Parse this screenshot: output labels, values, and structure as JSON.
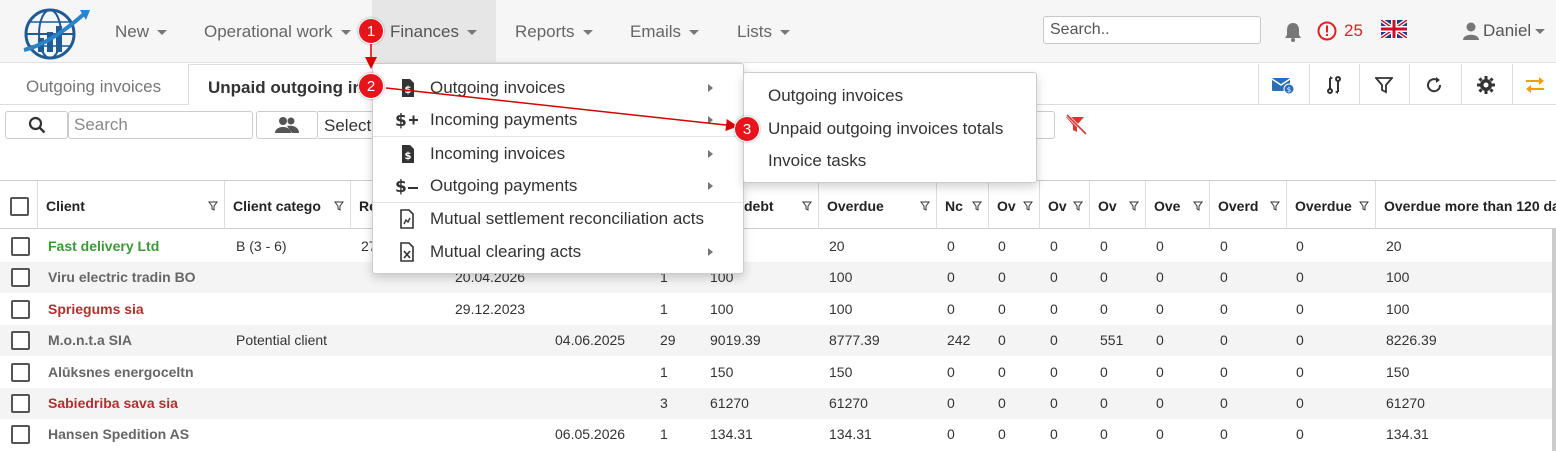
{
  "navbar": {
    "items": [
      {
        "label": "New"
      },
      {
        "label": "Operational work"
      },
      {
        "label": "Finances"
      },
      {
        "label": "Reports"
      },
      {
        "label": "Emails"
      },
      {
        "label": "Lists"
      }
    ],
    "search_placeholder": "Search..",
    "alert_count": "25",
    "user_name": "Daniel"
  },
  "tabs": [
    {
      "label": "Outgoing invoices"
    },
    {
      "label": "Unpaid outgoing invo"
    }
  ],
  "filter": {
    "search_placeholder": "Search",
    "select_text": "Select"
  },
  "finances_menu": {
    "items": [
      {
        "icon": "invoice-dollar-icon",
        "label": "Outgoing invoices",
        "submenu": true
      },
      {
        "icon": "dollar-plus-icon",
        "label": "Incoming payments",
        "submenu": true
      },
      {
        "icon": "invoice-dollar-icon",
        "label": "Incoming invoices",
        "submenu": true
      },
      {
        "icon": "dollar-minus-icon",
        "label": "Outgoing payments",
        "submenu": true
      },
      {
        "icon": "file-chart-icon",
        "label": "Mutual settlement reconciliation acts",
        "submenu": false
      },
      {
        "icon": "file-excel-icon",
        "label": "Mutual clearing acts",
        "submenu": true
      }
    ]
  },
  "submenu": {
    "items": [
      {
        "label": "Outgoing invoices"
      },
      {
        "label": "Unpaid outgoing invoices totals"
      },
      {
        "label": "Invoice tasks"
      }
    ]
  },
  "badges": [
    "1",
    "2",
    "3"
  ],
  "table": {
    "columns": [
      "Client",
      "Client catego",
      "Re",
      "",
      "",
      "",
      "debt",
      "Overdue",
      "Nc",
      "Ov",
      "Ov",
      "Ov",
      "Ove",
      "Overd",
      "Overdue",
      "Overdue more than 120 da"
    ],
    "rows": [
      {
        "client": "Fast delivery Ltd",
        "color": "green",
        "category": "B (3 - 6)",
        "re": "27",
        "date1": "",
        "date2": "",
        "count": "",
        "debt": "",
        "overdue": "20",
        "c8": "0",
        "c9": "0",
        "c10": "0",
        "c11": "0",
        "c12": "0",
        "c13": "0",
        "c14": "0",
        "c15": "20"
      },
      {
        "client": "Viru electric tradin BO",
        "color": "gray",
        "category": "",
        "re": "",
        "date1": "20.04.2026",
        "date2": "",
        "count": "1",
        "debt": "100",
        "overdue": "100",
        "c8": "0",
        "c9": "0",
        "c10": "0",
        "c11": "0",
        "c12": "0",
        "c13": "0",
        "c14": "0",
        "c15": "100"
      },
      {
        "client": "Spriegums sia",
        "color": "red",
        "category": "",
        "re": "",
        "date1": "29.12.2023",
        "date2": "",
        "count": "1",
        "debt": "100",
        "overdue": "100",
        "c8": "0",
        "c9": "0",
        "c10": "0",
        "c11": "0",
        "c12": "0",
        "c13": "0",
        "c14": "0",
        "c15": "100"
      },
      {
        "client": "M.o.n.t.a SIA",
        "color": "gray",
        "category": "Potential client",
        "re": "",
        "date1": "",
        "date2": "04.06.2025",
        "count": "29",
        "debt": "9019.39",
        "overdue": "8777.39",
        "c8": "242",
        "c9": "0",
        "c10": "0",
        "c11": "551",
        "c12": "0",
        "c13": "0",
        "c14": "0",
        "c15": "8226.39"
      },
      {
        "client": "Alūksnes energoceltn",
        "color": "gray",
        "category": "",
        "re": "",
        "date1": "",
        "date2": "",
        "count": "1",
        "debt": "150",
        "overdue": "150",
        "c8": "0",
        "c9": "0",
        "c10": "0",
        "c11": "0",
        "c12": "0",
        "c13": "0",
        "c14": "0",
        "c15": "150"
      },
      {
        "client": "Sabiedriba sava sia",
        "color": "red",
        "category": "",
        "re": "",
        "date1": "",
        "date2": "",
        "count": "3",
        "debt": "61270",
        "overdue": "61270",
        "c8": "0",
        "c9": "0",
        "c10": "0",
        "c11": "0",
        "c12": "0",
        "c13": "0",
        "c14": "0",
        "c15": "61270"
      },
      {
        "client": "Hansen Spedition AS",
        "color": "gray",
        "category": "",
        "re": "",
        "date1": "",
        "date2": "06.05.2026",
        "count": "1",
        "debt": "134.31",
        "overdue": "134.31",
        "c8": "0",
        "c9": "0",
        "c10": "0",
        "c11": "0",
        "c12": "0",
        "c13": "0",
        "c14": "0",
        "c15": "134.31"
      }
    ]
  },
  "colors": {
    "badge": "#e8141b",
    "arrow": "#d80000",
    "client_green": "#3a9a3a",
    "client_red": "#b03030",
    "accent_orange": "#f0a000"
  }
}
